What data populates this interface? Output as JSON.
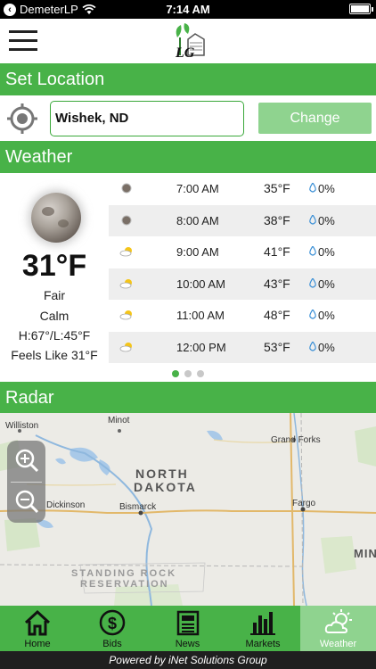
{
  "status_bar": {
    "back_label": "DemeterLP",
    "time": "7:14 AM"
  },
  "header": {
    "logo_text": "LG"
  },
  "location_section": {
    "title": "Set Location",
    "location_value": "Wishek, ND",
    "change_label": "Change"
  },
  "weather_section": {
    "title": "Weather",
    "current": {
      "icon": "moon-icon",
      "temperature": "31°F",
      "condition": "Fair",
      "wind": "Calm",
      "hi_lo": "H:67°/L:45°F",
      "feels_like": "Feels Like 31°F"
    },
    "hourly": [
      {
        "time": "7:00 AM",
        "temp": "35°F",
        "precip": "0%",
        "icon": "moon-icon"
      },
      {
        "time": "8:00 AM",
        "temp": "38°F",
        "precip": "0%",
        "icon": "moon-icon"
      },
      {
        "time": "9:00 AM",
        "temp": "41°F",
        "precip": "0%",
        "icon": "sun-cloud-icon"
      },
      {
        "time": "10:00 AM",
        "temp": "43°F",
        "precip": "0%",
        "icon": "sun-cloud-icon"
      },
      {
        "time": "11:00 AM",
        "temp": "48°F",
        "precip": "0%",
        "icon": "sun-cloud-icon"
      },
      {
        "time": "12:00 PM",
        "temp": "53°F",
        "precip": "0%",
        "icon": "sun-cloud-icon"
      }
    ],
    "pager": {
      "pages": 3,
      "active": 1
    }
  },
  "radar_section": {
    "title": "Radar",
    "map": {
      "cities": [
        "Williston",
        "Minot",
        "Grand Forks",
        "Bismarck",
        "Fargo",
        "Dickinson"
      ],
      "state_label_1": "NORTH",
      "state_label_2": "DAKOTA",
      "reservation_1": "STANDING ROCK",
      "reservation_2": "RESERVATION",
      "edge_label": "MIN"
    }
  },
  "bottom_nav": {
    "items": [
      {
        "label": "Home",
        "icon": "home-icon"
      },
      {
        "label": "Bids",
        "icon": "dollar-icon"
      },
      {
        "label": "News",
        "icon": "newspaper-icon"
      },
      {
        "label": "Markets",
        "icon": "bar-chart-icon"
      },
      {
        "label": "Weather",
        "icon": "sun-cloud-icon"
      }
    ],
    "active": "Weather"
  },
  "footer": {
    "text": "Powered by iNet Solutions Group"
  },
  "colors": {
    "brand_green": "#48b248",
    "light_green": "#8fd38f"
  }
}
